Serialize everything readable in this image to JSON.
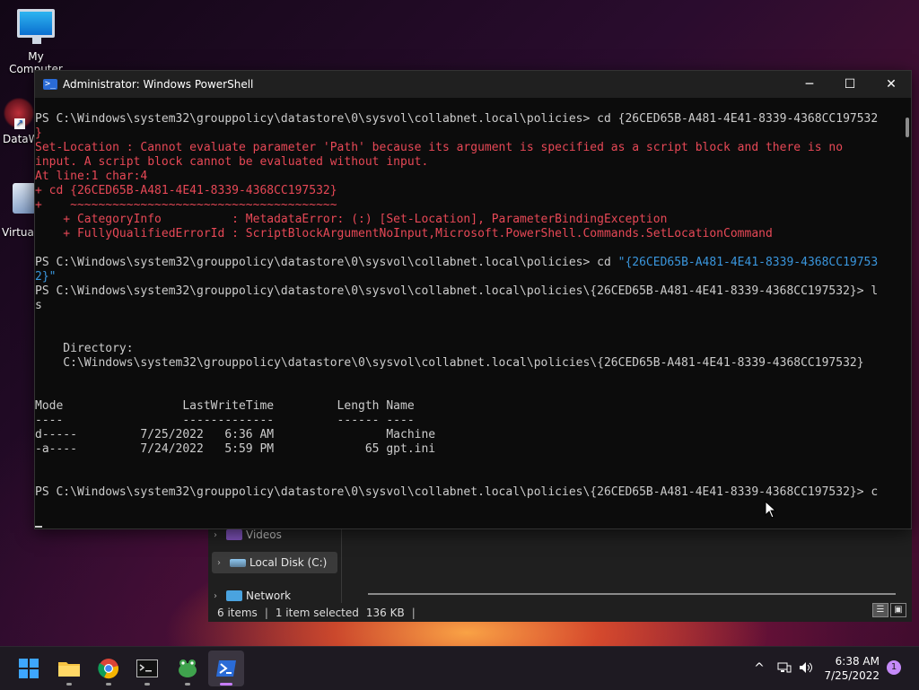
{
  "desktop": {
    "icons": [
      {
        "label": "My Computer",
        "icon": "monitor-icon"
      },
      {
        "label": "DataW",
        "icon": "app-shortcut-icon"
      },
      {
        "label": "Virtuall",
        "icon": "virtualbox-icon"
      }
    ]
  },
  "explorer": {
    "nav": [
      {
        "label": "Videos",
        "icon": "videos-folder-icon"
      },
      {
        "label": "Local Disk (C:)",
        "icon": "drive-icon"
      },
      {
        "label": "Network",
        "icon": "network-icon"
      }
    ],
    "status": {
      "items": "6 items",
      "selected": "1 item selected",
      "size": "136 KB",
      "sep": "|"
    }
  },
  "powershell": {
    "title": "Administrator: Windows PowerShell",
    "controls": {
      "minimize": "─",
      "maximize": "☐",
      "close": "✕"
    },
    "lines": [
      {
        "t": "",
        "c": "out"
      },
      {
        "t": "PS C:\\Windows\\system32\\grouppolicy\\datastore\\0\\sysvol\\collabnet.local\\policies> cd {26CED65B-A481-4E41-8339-4368CC197532",
        "c": "out"
      },
      {
        "t": "}",
        "c": "err"
      },
      {
        "t": "Set-Location : Cannot evaluate parameter 'Path' because its argument is specified as a script block and there is no",
        "c": "err"
      },
      {
        "t": "input. A script block cannot be evaluated without input.",
        "c": "err"
      },
      {
        "t": "At line:1 char:4",
        "c": "err"
      },
      {
        "t": "+ cd {26CED65B-A481-4E41-8339-4368CC197532}",
        "c": "err"
      },
      {
        "t": "+    ~~~~~~~~~~~~~~~~~~~~~~~~~~~~~~~~~~~~~~",
        "c": "err"
      },
      {
        "t": "    + CategoryInfo          : MetadataError: (:) [Set-Location], ParameterBindingException",
        "c": "err"
      },
      {
        "t": "    + FullyQualifiedErrorId : ScriptBlockArgumentNoInput,Microsoft.PowerShell.Commands.SetLocationCommand",
        "c": "err"
      },
      {
        "t": "",
        "c": "out"
      },
      {
        "t": "PS C:\\Windows\\system32\\grouppolicy\\datastore\\0\\sysvol\\collabnet.local\\policies> cd ",
        "c": "out",
        "s": "\"{26CED65B-A481-4E41-8339-4368CC19753"
      },
      {
        "t": "",
        "c": "out",
        "s": "2}\""
      },
      {
        "t": "PS C:\\Windows\\system32\\grouppolicy\\datastore\\0\\sysvol\\collabnet.local\\policies\\{26CED65B-A481-4E41-8339-4368CC197532}> l",
        "c": "out"
      },
      {
        "t": "s",
        "c": "out"
      },
      {
        "t": "",
        "c": "out"
      },
      {
        "t": "",
        "c": "out"
      },
      {
        "t": "    Directory:",
        "c": "out"
      },
      {
        "t": "    C:\\Windows\\system32\\grouppolicy\\datastore\\0\\sysvol\\collabnet.local\\policies\\{26CED65B-A481-4E41-8339-4368CC197532}",
        "c": "out"
      },
      {
        "t": "",
        "c": "out"
      },
      {
        "t": "",
        "c": "out"
      },
      {
        "t": "Mode                 LastWriteTime         Length Name",
        "c": "out"
      },
      {
        "t": "----                 -------------         ------ ----",
        "c": "out"
      },
      {
        "t": "d-----         7/25/2022   6:36 AM                Machine",
        "c": "out"
      },
      {
        "t": "-a----         7/24/2022   5:59 PM             65 gpt.ini",
        "c": "out"
      },
      {
        "t": "",
        "c": "out"
      },
      {
        "t": "",
        "c": "out"
      },
      {
        "t": "PS C:\\Windows\\system32\\grouppolicy\\datastore\\0\\sysvol\\collabnet.local\\policies\\{26CED65B-A481-4E41-8339-4368CC197532}> c",
        "c": "out"
      }
    ]
  },
  "taskbar": {
    "apps": [
      {
        "name": "start-button",
        "icon": "windows-logo-icon"
      },
      {
        "name": "file-explorer-button",
        "icon": "folder-icon"
      },
      {
        "name": "chrome-button",
        "icon": "chrome-icon"
      },
      {
        "name": "terminal-button",
        "icon": "terminal-icon"
      },
      {
        "name": "app-button",
        "icon": "frog-app-icon"
      },
      {
        "name": "powershell-button",
        "icon": "powershell-icon"
      }
    ],
    "tray_chevron": "^",
    "time": "6:38 AM",
    "date": "7/25/2022",
    "notification_count": "1"
  }
}
